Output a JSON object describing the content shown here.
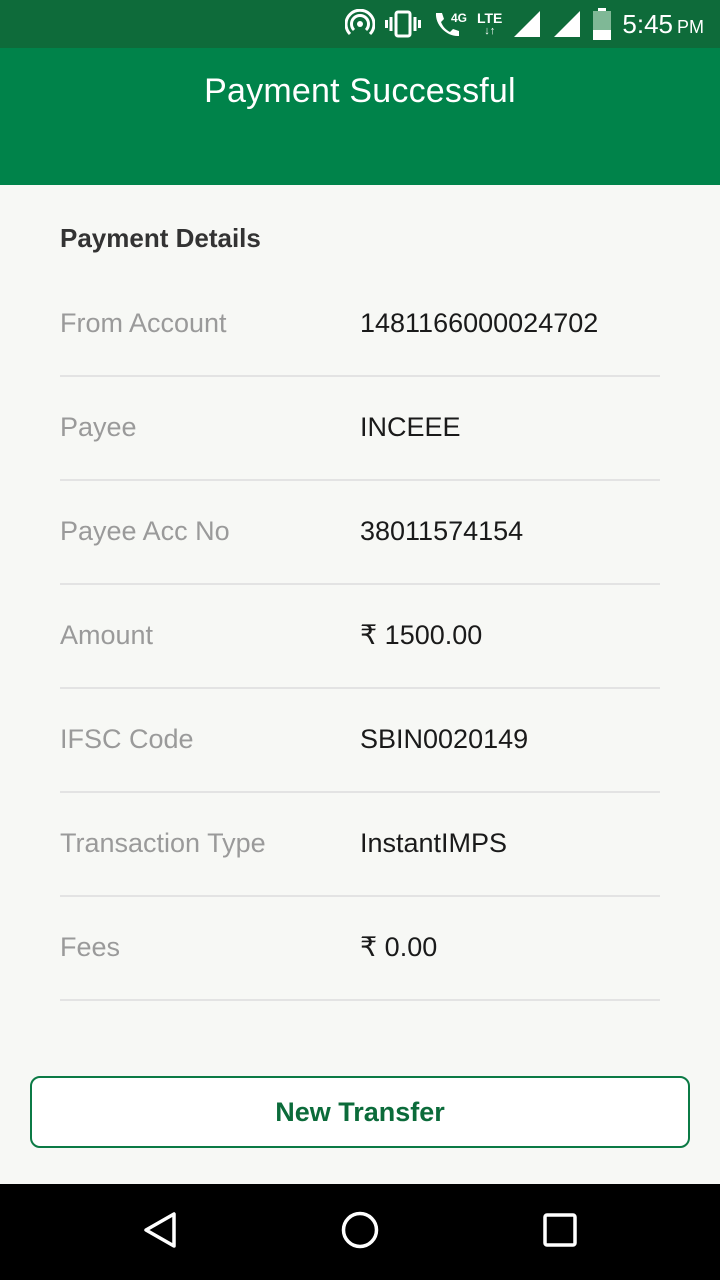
{
  "status_bar": {
    "network_small": "4G",
    "network_type": "LTE",
    "network_arrows": "↓↑",
    "time": "5:45",
    "ampm": "PM",
    "icons": [
      "hotspot-icon",
      "vibrate-icon",
      "wifi-calling-icon",
      "signal-icon",
      "signal-icon",
      "battery-icon"
    ]
  },
  "app_bar": {
    "title": "Payment Successful"
  },
  "details": {
    "section_title": "Payment Details",
    "rows": [
      {
        "label": "From Account",
        "value": "1481166000024702"
      },
      {
        "label": "Payee",
        "value": "INCEEE"
      },
      {
        "label": "Payee Acc No",
        "value": "38011574154"
      },
      {
        "label": "Amount",
        "value": "₹ 1500.00"
      },
      {
        "label": "IFSC Code",
        "value": "SBIN0020149"
      },
      {
        "label": "Transaction Type",
        "value": "InstantIMPS"
      },
      {
        "label": "Fees",
        "value": "₹ 0.00"
      }
    ]
  },
  "actions": {
    "new_transfer_label": "New Transfer"
  },
  "nav": {
    "icons": [
      "back-icon",
      "home-icon",
      "recents-icon"
    ]
  },
  "colors": {
    "status_bar": "#0e6b3a",
    "app_bar": "#00834a",
    "accent": "#0b7a45",
    "background": "#f7f8f5"
  }
}
